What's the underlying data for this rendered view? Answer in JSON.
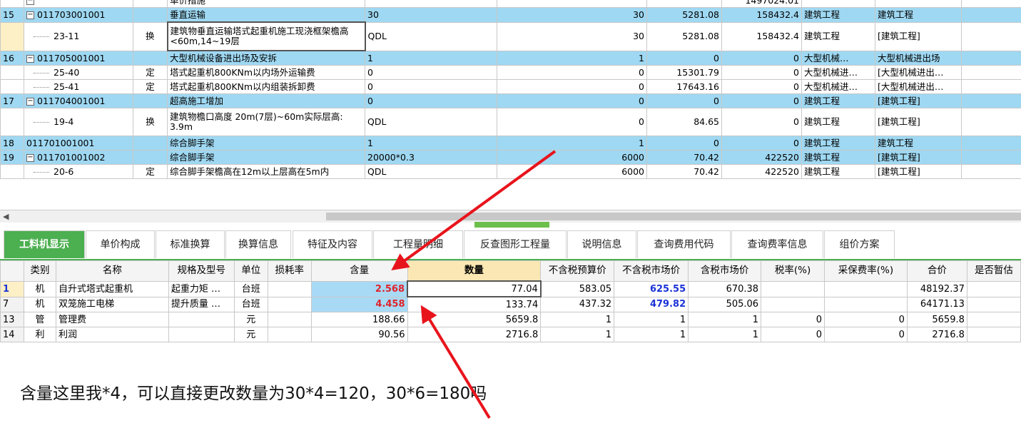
{
  "top_grid": {
    "rows": [
      {
        "rn": "",
        "code": "",
        "type": "",
        "name": "单价措施",
        "unit": "",
        "qty": "",
        "price": "",
        "total": "1497024.01",
        "cat": "",
        "sub": "",
        "style": "white",
        "collapse": true
      },
      {
        "rn": "15",
        "code": "011703001001",
        "type": "",
        "name": "垂直运输",
        "unit": "30",
        "qty": "30",
        "price": "5281.08",
        "total": "158432.4",
        "cat": "建筑工程",
        "sub": "建筑工程",
        "style": "blue",
        "collapse": true
      },
      {
        "rn": "",
        "code": "23-11",
        "type": "换",
        "name": "建筑物垂直运输塔式起重机施工现浇框架檐高<60m,14~19层",
        "unit": "QDL",
        "qty": "30",
        "price": "5281.08",
        "total": "158432.4",
        "cat": "建筑工程",
        "sub": "[建筑工程]",
        "style": "white",
        "child": true,
        "tall": true,
        "sel": true
      },
      {
        "rn": "16",
        "code": "011705001001",
        "type": "",
        "name": "大型机械设备进出场及安拆",
        "unit": "1",
        "qty": "1",
        "price": "0",
        "total": "0",
        "cat": "大型机械…",
        "sub": "大型机械进出场",
        "style": "blue",
        "collapse": true
      },
      {
        "rn": "",
        "code": "25-40",
        "type": "定",
        "name": "塔式起重机800KNm以内场外运输费",
        "unit": "0",
        "qty": "0",
        "price": "15301.79",
        "total": "0",
        "cat": "大型机械进…",
        "sub": "[大型机械进出…",
        "style": "white",
        "child": true
      },
      {
        "rn": "",
        "code": "25-41",
        "type": "定",
        "name": "塔式起重机800KNm以内组装拆卸费",
        "unit": "0",
        "qty": "0",
        "price": "17643.16",
        "total": "0",
        "cat": "大型机械进…",
        "sub": "[大型机械进出…",
        "style": "white",
        "child": true
      },
      {
        "rn": "17",
        "code": "011704001001",
        "type": "",
        "name": "超高施工增加",
        "unit": "0",
        "qty": "0",
        "price": "0",
        "total": "0",
        "cat": "建筑工程",
        "sub": "[建筑工程]",
        "style": "blue",
        "collapse": true
      },
      {
        "rn": "",
        "code": "19-4",
        "type": "换",
        "name": "建筑物檐口高度 20m(7层)~60m实际层高: 3.9m",
        "unit": "QDL",
        "qty": "0",
        "price": "84.65",
        "total": "0",
        "cat": "建筑工程",
        "sub": "[建筑工程]",
        "style": "white",
        "child": true,
        "tall": true
      },
      {
        "rn": "18",
        "code": "011701001001",
        "type": "",
        "name": "综合脚手架",
        "unit": "1",
        "qty": "1",
        "price": "0",
        "total": "0",
        "cat": "建筑工程",
        "sub": "建筑工程",
        "style": "blue"
      },
      {
        "rn": "19",
        "code": "011701001002",
        "type": "",
        "name": "综合脚手架",
        "unit": "20000*0.3",
        "qty": "6000",
        "price": "70.42",
        "total": "422520",
        "cat": "建筑工程",
        "sub": "[建筑工程]",
        "style": "blue",
        "collapse": true
      },
      {
        "rn": "",
        "code": "20-6",
        "type": "定",
        "name": "综合脚手架檐高在12m以上层高在5m内",
        "unit": "QDL",
        "qty": "6000",
        "price": "70.42",
        "total": "422520",
        "cat": "建筑工程",
        "sub": "[建筑工程]",
        "style": "white",
        "child": true
      }
    ]
  },
  "tabs": [
    "工料机显示",
    "单价构成",
    "标准换算",
    "换算信息",
    "特征及内容",
    "工程量明细",
    "反查图形工程量",
    "说明信息",
    "查询费用代码",
    "查询费率信息",
    "组价方案"
  ],
  "bottom_grid": {
    "headers": [
      "类别",
      "名称",
      "规格及型号",
      "单位",
      "损耗率",
      "含量",
      "数量",
      "不含税预算价",
      "不含税市场价",
      "含税市场价",
      "税率(%)",
      "采保费率(%)",
      "合价",
      "是否暂估"
    ],
    "rows": [
      {
        "rn": "1",
        "cls": "机",
        "name": "自升式塔式起重机",
        "spec": "起重力矩 …",
        "unit": "台班",
        "loss": "",
        "content": "2.568",
        "qty": "77.04",
        "budget": "583.05",
        "market": "625.55",
        "tax_market": "670.38",
        "tax": "",
        "bao": "",
        "total": "48192.37"
      },
      {
        "rn": "7",
        "cls": "机",
        "name": "双笼施工电梯",
        "spec": "提升质量 …",
        "unit": "台班",
        "loss": "",
        "content": "4.458",
        "qty": "133.74",
        "budget": "437.32",
        "market": "479.82",
        "tax_market": "505.06",
        "tax": "",
        "bao": "",
        "total": "64171.13"
      },
      {
        "rn": "13",
        "cls": "管",
        "name": "管理费",
        "spec": "",
        "unit": "元",
        "loss": "",
        "content": "188.66",
        "qty": "5659.8",
        "budget": "1",
        "market": "1",
        "tax_market": "1",
        "tax": "0",
        "bao": "0",
        "total": "5659.8"
      },
      {
        "rn": "14",
        "cls": "利",
        "name": "利润",
        "spec": "",
        "unit": "元",
        "loss": "",
        "content": "90.56",
        "qty": "2716.8",
        "budget": "1",
        "market": "1",
        "tax_market": "1",
        "tax": "0",
        "bao": "0",
        "total": "2716.8"
      }
    ]
  },
  "comment": "含量这里我*4，可以直接更改数量为30*4=120，30*6=180吗",
  "colors": {
    "accent_green": "#4caf50",
    "row_blue": "#9fd8f2",
    "arrow_red": "#e8141c",
    "value_red": "#e0242c",
    "value_blue": "#1a33d6"
  }
}
